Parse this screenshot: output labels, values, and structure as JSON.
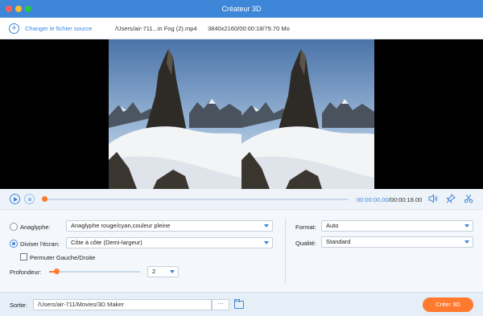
{
  "window": {
    "title": "Créateur 3D"
  },
  "source": {
    "add_icon": "plus-circle-icon",
    "add_label": "Changer le fichier source",
    "file_path": "/Users/air-711...in Fog (2).mp4",
    "file_info": "3840x2160/00:00:18/79.70 Mo"
  },
  "player": {
    "current_time": "00:00:00.00",
    "total_time": "/00:00:18.00",
    "progress": 0,
    "icons": [
      "play-icon",
      "stop-icon",
      "volume-icon",
      "pin-icon",
      "scissors-icon"
    ]
  },
  "settings": {
    "anaglyph": {
      "label": "Anaglyphe:",
      "value": "Anaglyphe rouge/cyan,couleur pleine",
      "selected": false
    },
    "split": {
      "label": "Diviser l'écran:",
      "value": "Côte à côte (Demi-largeur)",
      "selected": true
    },
    "swap": {
      "label": "Permuter Gauche/Droite",
      "checked": false
    },
    "depth": {
      "label": "Profondeur:",
      "value": "2",
      "level": 0.08
    },
    "format": {
      "label": "Format:",
      "value": "Auto"
    },
    "quality": {
      "label": "Qualité:",
      "value": "Standard"
    }
  },
  "output": {
    "label": "Sortie:",
    "path": "/Users/air-711/Movies/3D Maker",
    "browse_label": "···",
    "create_label": "Créer 3D"
  },
  "colors": {
    "accent": "#3d86d8",
    "action": "#ff7a2e"
  }
}
